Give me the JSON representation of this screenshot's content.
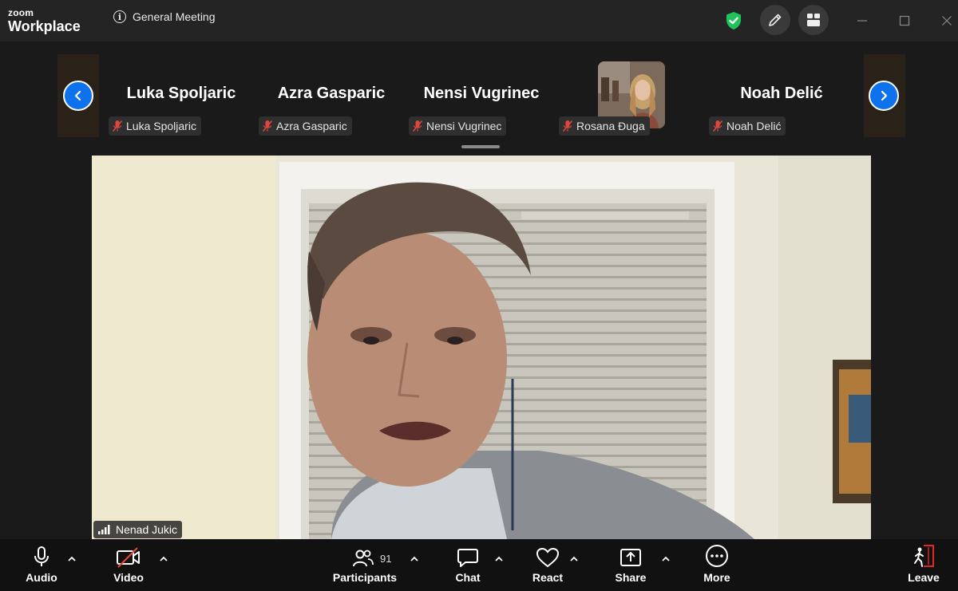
{
  "app": {
    "brand_small": "zoom",
    "brand_large": "Workplace"
  },
  "meeting": {
    "title": "General Meeting"
  },
  "strip": {
    "tiles": [
      {
        "display_name": "Luka Spoljaric",
        "label": "Luka Spoljaric",
        "muted": true
      },
      {
        "display_name": "Azra Gasparic",
        "label": "Azra Gasparic",
        "muted": true
      },
      {
        "display_name": "Nensi Vugrinec",
        "label": "Nensi Vugrinec",
        "muted": true
      },
      {
        "display_name": "",
        "label": "Rosana Đuga",
        "muted": true,
        "has_video": true
      },
      {
        "display_name": "Noah Delić",
        "label": "Noah Delić",
        "muted": true
      }
    ]
  },
  "main_video": {
    "speaker": "Nenad Jukic"
  },
  "toolbar": {
    "audio": "Audio",
    "video": "Video",
    "participants": "Participants",
    "participants_count": "91",
    "chat": "Chat",
    "react": "React",
    "share": "Share",
    "more": "More",
    "leave": "Leave"
  },
  "colors": {
    "accent": "#0e72ed",
    "secure": "#20c35a",
    "leave": "#e02828",
    "muted": "#e0473c"
  }
}
